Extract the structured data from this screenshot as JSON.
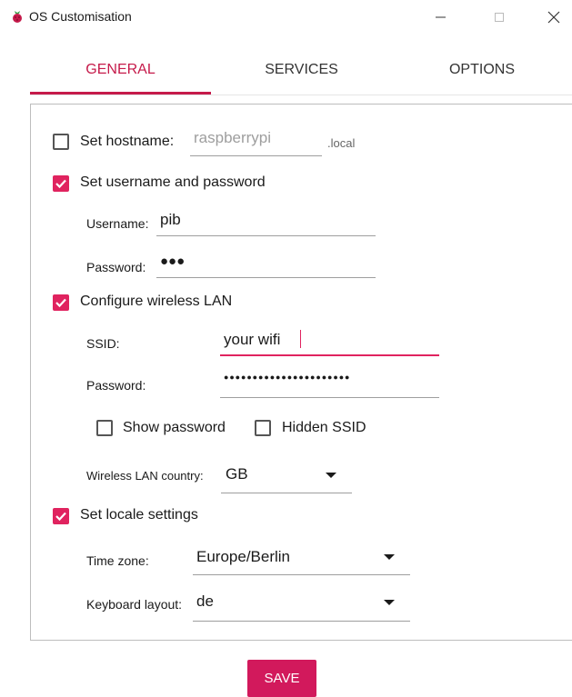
{
  "window": {
    "title": "OS Customisation",
    "icon": "raspberry-icon",
    "controls": [
      "minimize",
      "maximize",
      "close"
    ]
  },
  "tabs": [
    {
      "label": "GENERAL",
      "active": true
    },
    {
      "label": "SERVICES",
      "active": false
    },
    {
      "label": "OPTIONS",
      "active": false
    }
  ],
  "general": {
    "hostname": {
      "label": "Set hostname:",
      "checked": false,
      "placeholder": "raspberrypi",
      "suffix": ".local"
    },
    "user": {
      "label": "Set username and password",
      "checked": true,
      "username_label": "Username:",
      "username_value": "pib",
      "password_label": "Password:",
      "password_mask": "●●●"
    },
    "wlan": {
      "label": "Configure wireless LAN",
      "checked": true,
      "ssid_label": "SSID:",
      "ssid_value": "your wifi",
      "password_label": "Password:",
      "password_mask": "●●●●●●●●●●●●●●●●●●●●●●",
      "show_password_label": "Show password",
      "show_password_checked": false,
      "hidden_ssid_label": "Hidden SSID",
      "hidden_ssid_checked": false,
      "country_label": "Wireless LAN country:",
      "country_value": "GB"
    },
    "locale": {
      "label": "Set locale settings",
      "checked": true,
      "timezone_label": "Time zone:",
      "timezone_value": "Europe/Berlin",
      "keyboard_label": "Keyboard layout:",
      "keyboard_value": "de"
    }
  },
  "save_label": "SAVE",
  "colors": {
    "accent": "#e0235f",
    "save_button": "#d2195c"
  }
}
